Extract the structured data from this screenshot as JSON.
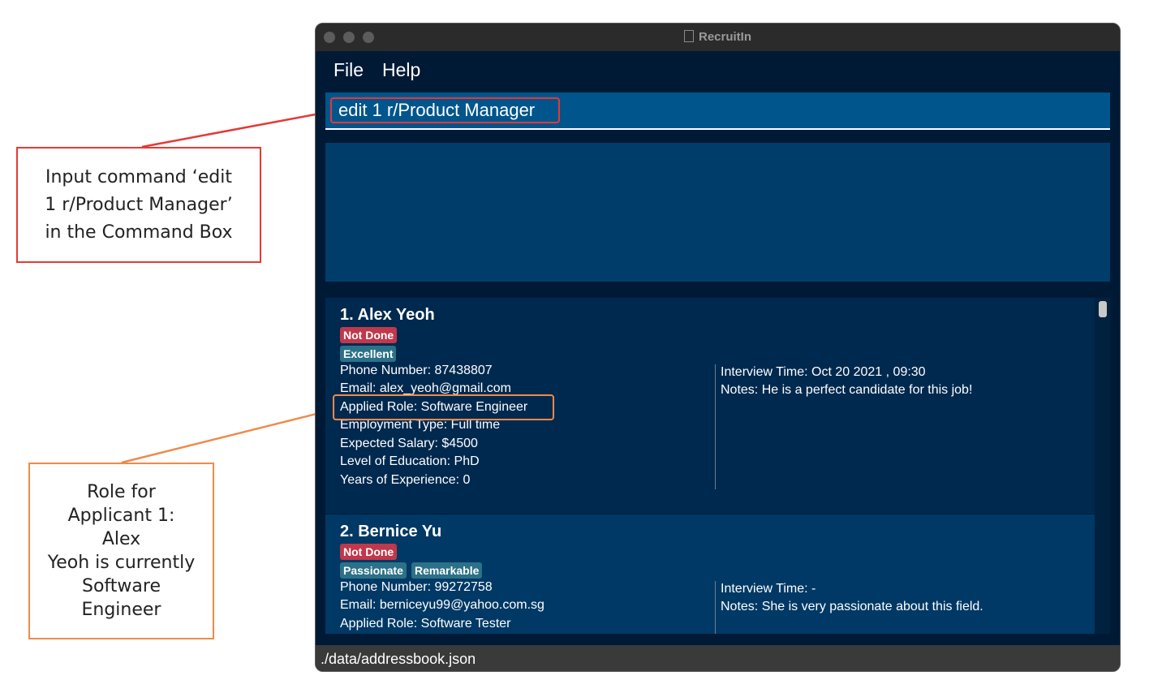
{
  "annotations": {
    "command": "Input command ‘edit\n1 r/Product Manager’\nin the Command Box",
    "role": "Role for\nApplicant 1:\nAlex\nYeoh is currently\nSoftware\nEngineer"
  },
  "window": {
    "title": "RecruitIn"
  },
  "menu": {
    "file": "File",
    "help": "Help"
  },
  "command_box": {
    "value": "edit 1 r/Product Manager"
  },
  "result_box": {
    "text": ""
  },
  "applicants": [
    {
      "name": "1.  Alex Yeoh",
      "status": "Not Done",
      "tags": [
        "Excellent"
      ],
      "phone": "Phone Number: 87438807",
      "email": "Email: alex_yeoh@gmail.com",
      "role": "Applied Role: Software Engineer",
      "employment": "Employment Type: Full time",
      "salary": "Expected Salary: $4500",
      "education": "Level of Education: PhD",
      "experience": "Years of Experience: 0",
      "interview": "Interview Time: Oct 20 2021 , 09:30",
      "notes": "Notes: He is a perfect candidate for this job!"
    },
    {
      "name": "2.  Bernice Yu",
      "status": "Not Done",
      "tags": [
        "Passionate",
        "Remarkable"
      ],
      "phone": "Phone Number: 99272758",
      "email": "Email: berniceyu99@yahoo.com.sg",
      "role": "Applied Role: Software Tester",
      "interview": "Interview Time: -",
      "notes": "Notes: She is very passionate about this field."
    }
  ],
  "status_bar": {
    "path": "./data/addressbook.json"
  },
  "colors": {
    "annotation_red": "#e53935",
    "annotation_orange": "#ef8a4a",
    "status_badge": "#c0384b",
    "tag_badge": "#2b7187"
  }
}
